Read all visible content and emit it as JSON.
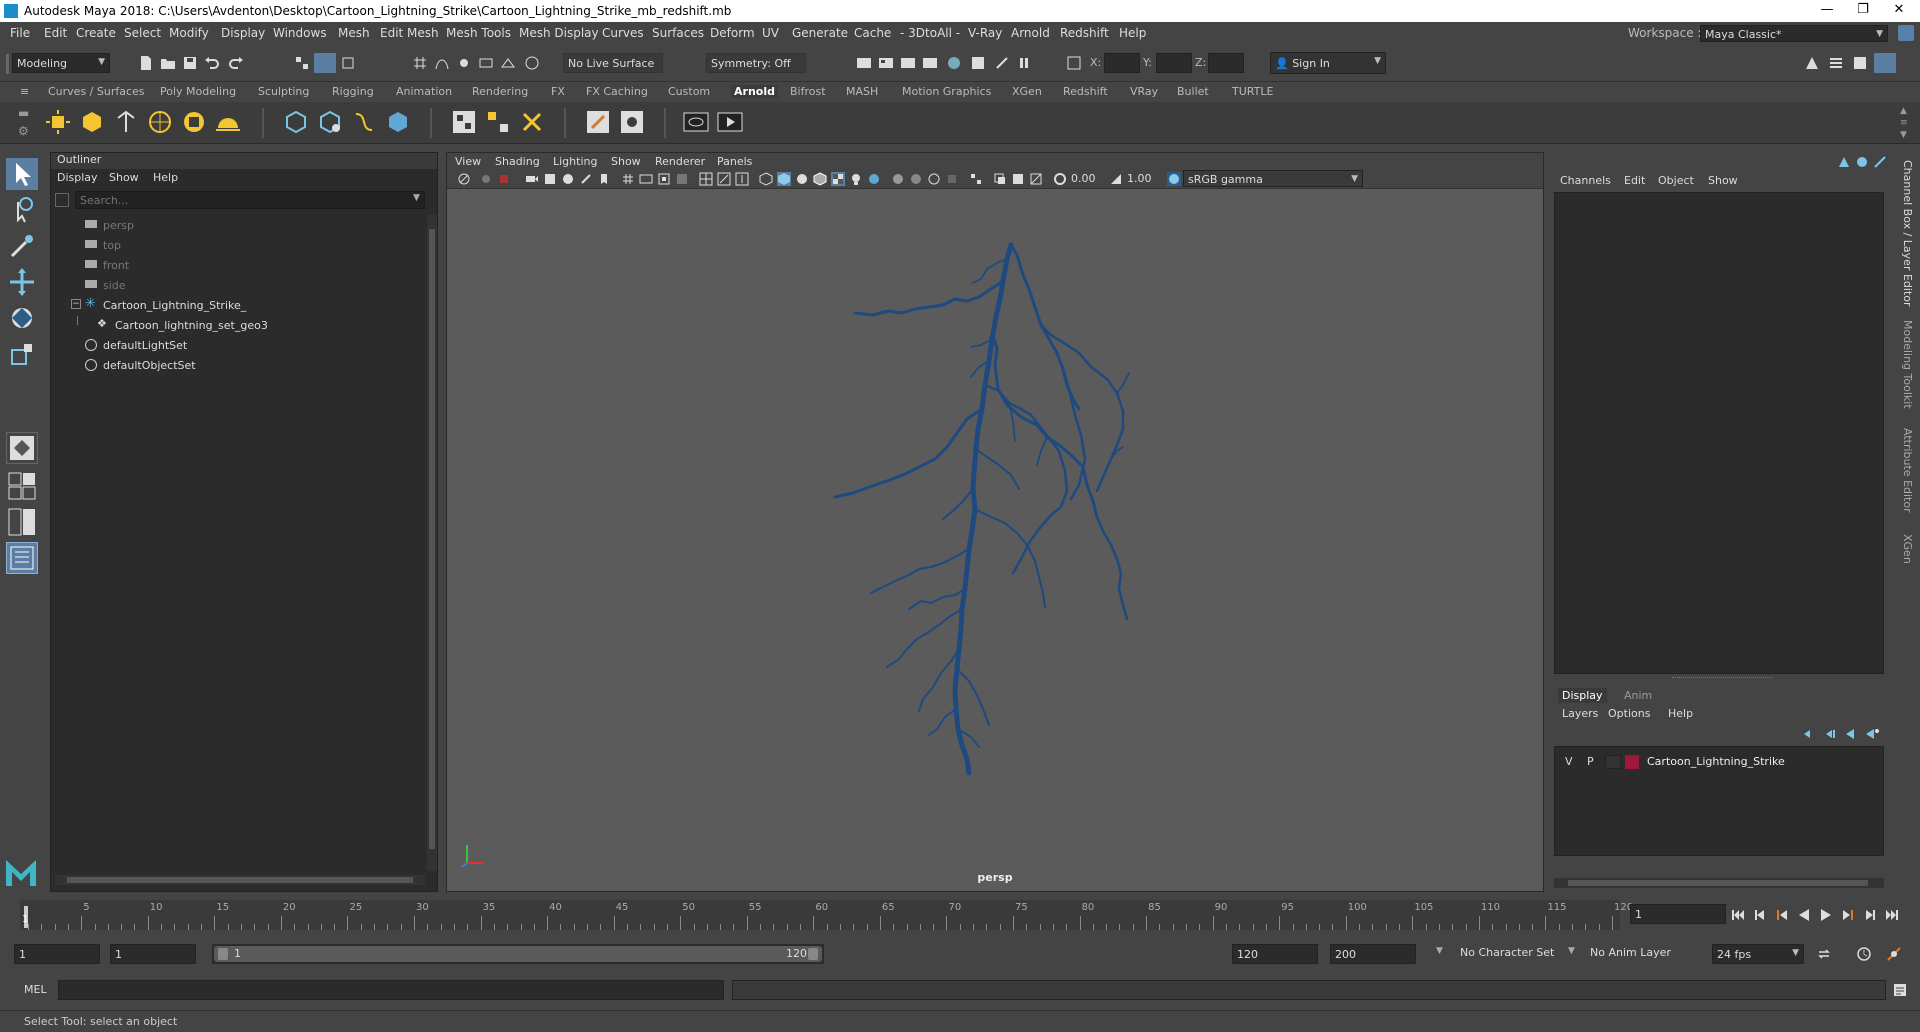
{
  "window": {
    "title": "Autodesk Maya 2018: C:\\Users\\Avdenton\\Desktop\\Cartoon_Lightning_Strike\\Cartoon_Lightning_Strike_mb_redshift.mb",
    "minimize": "—",
    "maximize": "❐",
    "close": "✕"
  },
  "menubar": {
    "items": [
      "File",
      "Edit",
      "Create",
      "Select",
      "Modify",
      "Display",
      "Windows",
      "Mesh",
      "Edit Mesh",
      "Mesh Tools",
      "Mesh Display",
      "Curves",
      "Surfaces",
      "Deform",
      "UV",
      "Generate",
      "Cache",
      "- 3DtoAll -",
      "V-Ray",
      "Arnold",
      "Redshift",
      "Help"
    ],
    "workspace_label": "Workspace :",
    "workspace_value": "Maya Classic*"
  },
  "statusline": {
    "mode": "Modeling",
    "live_surface": "No Live Surface",
    "symmetry": "Symmetry: Off",
    "x_label": "X:",
    "y_label": "Y:",
    "z_label": "Z:",
    "sign_in": "Sign In"
  },
  "shelf": {
    "tabs": [
      "Curves / Surfaces",
      "Poly Modeling",
      "Sculpting",
      "Rigging",
      "Animation",
      "Rendering",
      "FX",
      "FX Caching",
      "Custom",
      "Arnold",
      "Bifrost",
      "MASH",
      "Motion Graphics",
      "XGen",
      "Redshift",
      "VRay",
      "Bullet",
      "TURTLE"
    ],
    "active_tab": "Arnold"
  },
  "outliner": {
    "title": "Outliner",
    "menu": [
      "Display",
      "Show",
      "Help"
    ],
    "search_placeholder": "Search...",
    "rows": [
      {
        "label": "persp",
        "icon": "camera-icon",
        "dim": true
      },
      {
        "label": "top",
        "icon": "camera-icon",
        "dim": true
      },
      {
        "label": "front",
        "icon": "camera-icon",
        "dim": true
      },
      {
        "label": "side",
        "icon": "camera-icon",
        "dim": true
      },
      {
        "label": "Cartoon_Lightning_Strike_",
        "icon": "group-icon",
        "dim": false
      },
      {
        "label": "Cartoon_lightning_set_geo3",
        "icon": "mesh-icon",
        "dim": false
      },
      {
        "label": "defaultLightSet",
        "icon": "set-icon",
        "dim": false
      },
      {
        "label": "defaultObjectSet",
        "icon": "set-icon",
        "dim": false
      }
    ]
  },
  "viewport": {
    "menu": [
      "View",
      "Shading",
      "Lighting",
      "Show",
      "Renderer",
      "Panels"
    ],
    "exposure": "0.00",
    "gamma": "1.00",
    "color_space": "sRGB gamma",
    "camera_label": "persp",
    "lightning_color": "#1e4a80"
  },
  "channelbox": {
    "menu": [
      "Channels",
      "Edit",
      "Object",
      "Show"
    ],
    "layer_tabs": [
      "Display",
      "Anim"
    ],
    "layer_menu": [
      "Layers",
      "Options",
      "Help"
    ],
    "layer": {
      "v": "V",
      "p": "P",
      "name": "Cartoon_Lightning_Strike",
      "color": "#a0183c"
    },
    "side_tabs": [
      "Channel Box / Layer Editor",
      "Modeling Toolkit",
      "Attribute Editor",
      "XGen"
    ]
  },
  "timeslider": {
    "ticks": [
      "5",
      "10",
      "15",
      "20",
      "25",
      "30",
      "35",
      "40",
      "45",
      "50",
      "55",
      "60",
      "65",
      "70",
      "75",
      "80",
      "85",
      "90",
      "95",
      "100",
      "105",
      "110",
      "115",
      "120"
    ],
    "start_marker": "1",
    "current_frame": "1"
  },
  "rangeslider": {
    "start": "1",
    "playback_start": "1",
    "range_start": "1",
    "range_end": "120",
    "playback_end": "120",
    "end": "200",
    "character_set": "No Character Set",
    "anim_layer": "No Anim Layer",
    "fps": "24 fps"
  },
  "cmdline": {
    "label": "MEL"
  },
  "helpline": {
    "text": "Select Tool: select an object"
  }
}
